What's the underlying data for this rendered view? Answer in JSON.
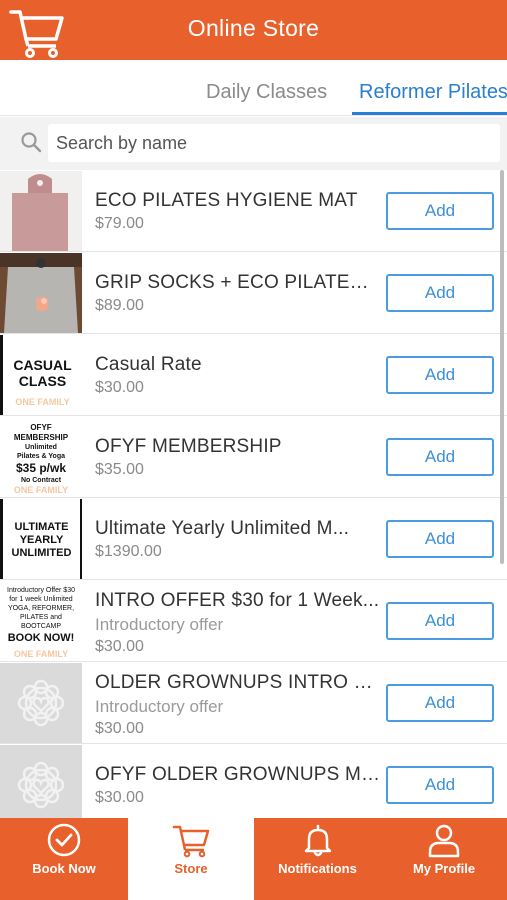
{
  "header": {
    "title": "Online Store",
    "cart_icon": "cart-icon",
    "color": "#e8612c"
  },
  "tabs": [
    {
      "label": "Daily Classes"
    },
    {
      "label": "Reformer Pilates"
    }
  ],
  "search": {
    "placeholder": "Search by name",
    "icon": "search-icon"
  },
  "products": [
    {
      "name": "ECO PILATES HYGIENE MAT",
      "subtitle": "",
      "price": "$79.00",
      "button": "Add"
    },
    {
      "name": "GRIP SOCKS + ECO PILATES ...",
      "subtitle": "",
      "price": "$89.00",
      "button": "Add"
    },
    {
      "name": "Casual Rate",
      "subtitle": "",
      "price": "$30.00",
      "button": "Add"
    },
    {
      "name": "OFYF MEMBERSHIP",
      "subtitle": "",
      "price": "$35.00",
      "button": "Add"
    },
    {
      "name": "Ultimate Yearly Unlimited M...",
      "subtitle": "",
      "price": "$1390.00",
      "button": "Add"
    },
    {
      "name": "INTRO OFFER $30 for 1 Week...",
      "subtitle": "Introductory offer",
      "price": "$30.00",
      "button": "Add"
    },
    {
      "name": "OLDER GROWNUPS INTRO O...",
      "subtitle": "Introductory offer",
      "price": "$30.00",
      "button": "Add"
    },
    {
      "name": "OFYF OLDER GROWNUPS ME...",
      "subtitle": "",
      "price": "$30.00",
      "button": "Add"
    }
  ],
  "thumbs": {
    "casual": [
      "CASUAL",
      "CLASS"
    ],
    "casual_wm": "ONE FAMILY",
    "membership": [
      "OFYF",
      "MEMBERSHIP",
      "Unlimited",
      "Pilates & Yoga",
      "$35 p/wk",
      "No Contract"
    ],
    "membership_wm": "ONE FAMILY",
    "ultimate": [
      "ULTIMATE",
      "YEARLY",
      "UNLIMITED"
    ],
    "intro": [
      "Introductory Offer $30",
      "for 1 week Unlimited",
      "YOGA, REFORMER,",
      "PILATES and",
      "BOOTCAMP",
      "BOOK NOW!"
    ],
    "intro_wm": "ONE FAMILY"
  },
  "tabbar": [
    {
      "label": "Book Now",
      "icon": "check-circle-icon"
    },
    {
      "label": "Store",
      "icon": "cart-icon"
    },
    {
      "label": "Notifications",
      "icon": "bell-icon"
    },
    {
      "label": "My Profile",
      "icon": "user-icon"
    }
  ],
  "colors": {
    "accent": "#e8612c",
    "link": "#2a7fd0"
  }
}
